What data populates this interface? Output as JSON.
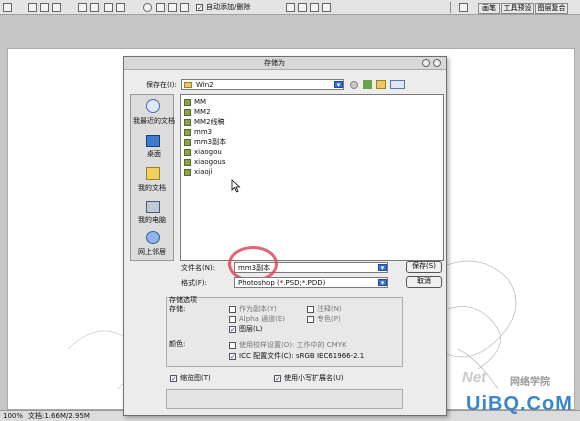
{
  "toolbar": {
    "auto_add_delete_label": "自动添加/删除"
  },
  "panel_tabs": [
    "画笔",
    "工具预设",
    "图层复合"
  ],
  "dialog": {
    "title": "存储为",
    "save_in_label": "保存在(I):",
    "save_in_value": "Win2",
    "places": [
      {
        "label": "我最近的文档",
        "icon": "recent-documents-icon"
      },
      {
        "label": "桌面",
        "icon": "desktop-icon"
      },
      {
        "label": "我的文档",
        "icon": "my-documents-icon"
      },
      {
        "label": "我的电脑",
        "icon": "my-computer-icon"
      },
      {
        "label": "网上邻居",
        "icon": "network-places-icon"
      }
    ],
    "files": [
      "MM",
      "MM2",
      "MM2线稿",
      "mm3",
      "mm3副本",
      "xiaogou",
      "xiaogous",
      "xiaoji"
    ],
    "filename_label": "文件名(N):",
    "filename_value": "mm3副本",
    "format_label": "格式(F):",
    "format_value": "Photoshop (*.PSD;*.PDD)",
    "save_button": "保存(S)",
    "cancel_button": "取消",
    "options_title": "存储选项",
    "storage_label": "存储:",
    "opt_as_copy": "作为副本(Y)",
    "opt_annotations": "注释(N)",
    "opt_alpha": "Alpha 通道(E)",
    "opt_spot": "专色(P)",
    "opt_layers": "图层(L)",
    "color_label": "颜色:",
    "opt_proof": "使用校样设置(O): 工作中的 CMYK",
    "opt_icc": "ICC 配置文件(C): sRGB IEC61966-2.1",
    "opt_thumbnail": "缩览图(T)",
    "opt_lowercase": "使用小写扩展名(U)"
  },
  "statusbar": {
    "zoom": "100%",
    "doc_info": "文档:1.66M/2.95M"
  },
  "watermark": {
    "brand": "Net",
    "chinese": "网络学院",
    "site": "UiBQ.CoM"
  }
}
